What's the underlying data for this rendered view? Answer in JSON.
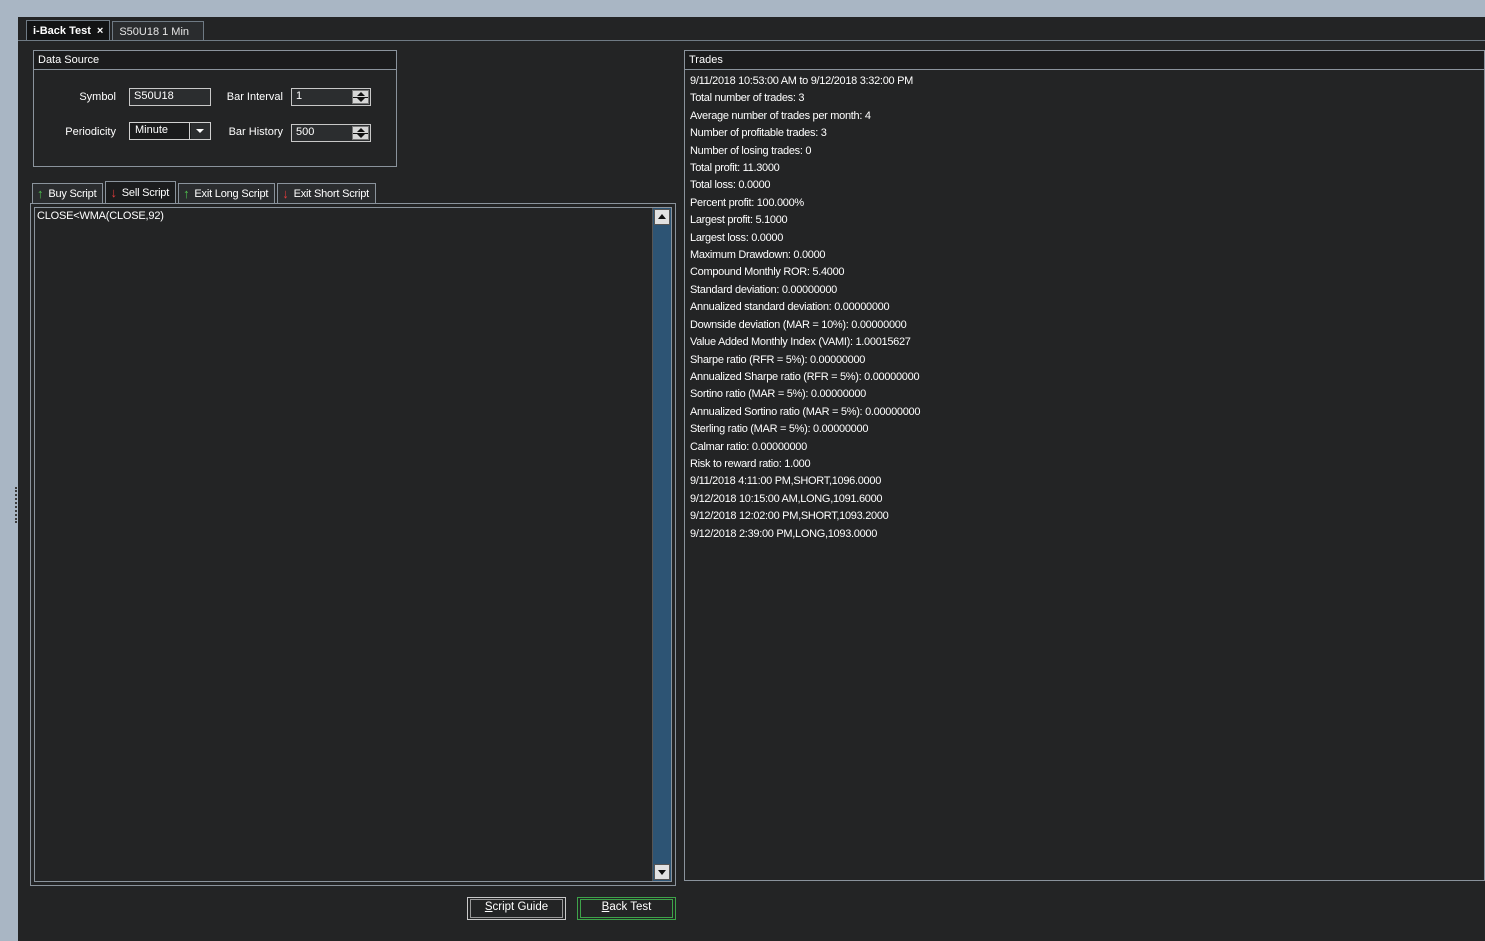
{
  "doc_tabs": [
    {
      "label": "i-Back Test",
      "close": "×"
    },
    {
      "label": "S50U18 1 Min"
    }
  ],
  "data_source": {
    "title": "Data Source",
    "symbol_label": "Symbol",
    "symbol_value": "S50U18",
    "bar_interval_label": "Bar Interval",
    "bar_interval_value": "1",
    "periodicity_label": "Periodicity",
    "periodicity_value": "Minute",
    "bar_history_label": "Bar History",
    "bar_history_value": "500"
  },
  "script_tabs": [
    {
      "label": "Buy Script",
      "icon": "arrow-up-green"
    },
    {
      "label": "Sell Script",
      "icon": "arrow-down-red"
    },
    {
      "label": "Exit Long Script",
      "icon": "arrow-up-green"
    },
    {
      "label": "Exit Short Script",
      "icon": "arrow-down-red"
    }
  ],
  "editor": {
    "text": "CLOSE<WMA(CLOSE,92)"
  },
  "buttons": {
    "script_guide": {
      "first": "S",
      "rest": "cript Guide"
    },
    "back_test": {
      "first": "B",
      "rest": "ack Test"
    }
  },
  "trades": {
    "title": "Trades",
    "lines": [
      "9/11/2018 10:53:00 AM to 9/12/2018 3:32:00 PM",
      "Total number of trades: 3",
      "Average number of trades per month: 4",
      "Number of profitable trades: 3",
      "Number of losing trades: 0",
      "Total profit: 11.3000",
      "Total loss: 0.0000",
      "Percent profit: 100.000%",
      "Largest profit: 5.1000",
      "Largest loss: 0.0000",
      "Maximum Drawdown: 0.0000",
      "Compound Monthly ROR: 5.4000",
      "Standard deviation: 0.00000000",
      "Annualized standard deviation: 0.00000000",
      "Downside deviation (MAR = 10%): 0.00000000",
      "Value Added Monthly Index (VAMI): 1.00015627",
      "Sharpe ratio (RFR = 5%): 0.00000000",
      "Annualized Sharpe ratio (RFR = 5%): 0.00000000",
      "Sortino ratio (MAR = 5%): 0.00000000",
      "Annualized Sortino ratio (MAR = 5%): 0.00000000",
      "Sterling ratio (MAR = 5%): 0.00000000",
      "Calmar ratio: 0.00000000",
      "Risk to reward ratio: 1.000",
      "9/11/2018 4:11:00 PM,SHORT,1096.0000",
      "9/12/2018 10:15:00 AM,LONG,1091.6000",
      "9/12/2018 12:02:00 PM,SHORT,1093.2000",
      "9/12/2018 2:39:00 PM,LONG,1093.0000"
    ]
  }
}
